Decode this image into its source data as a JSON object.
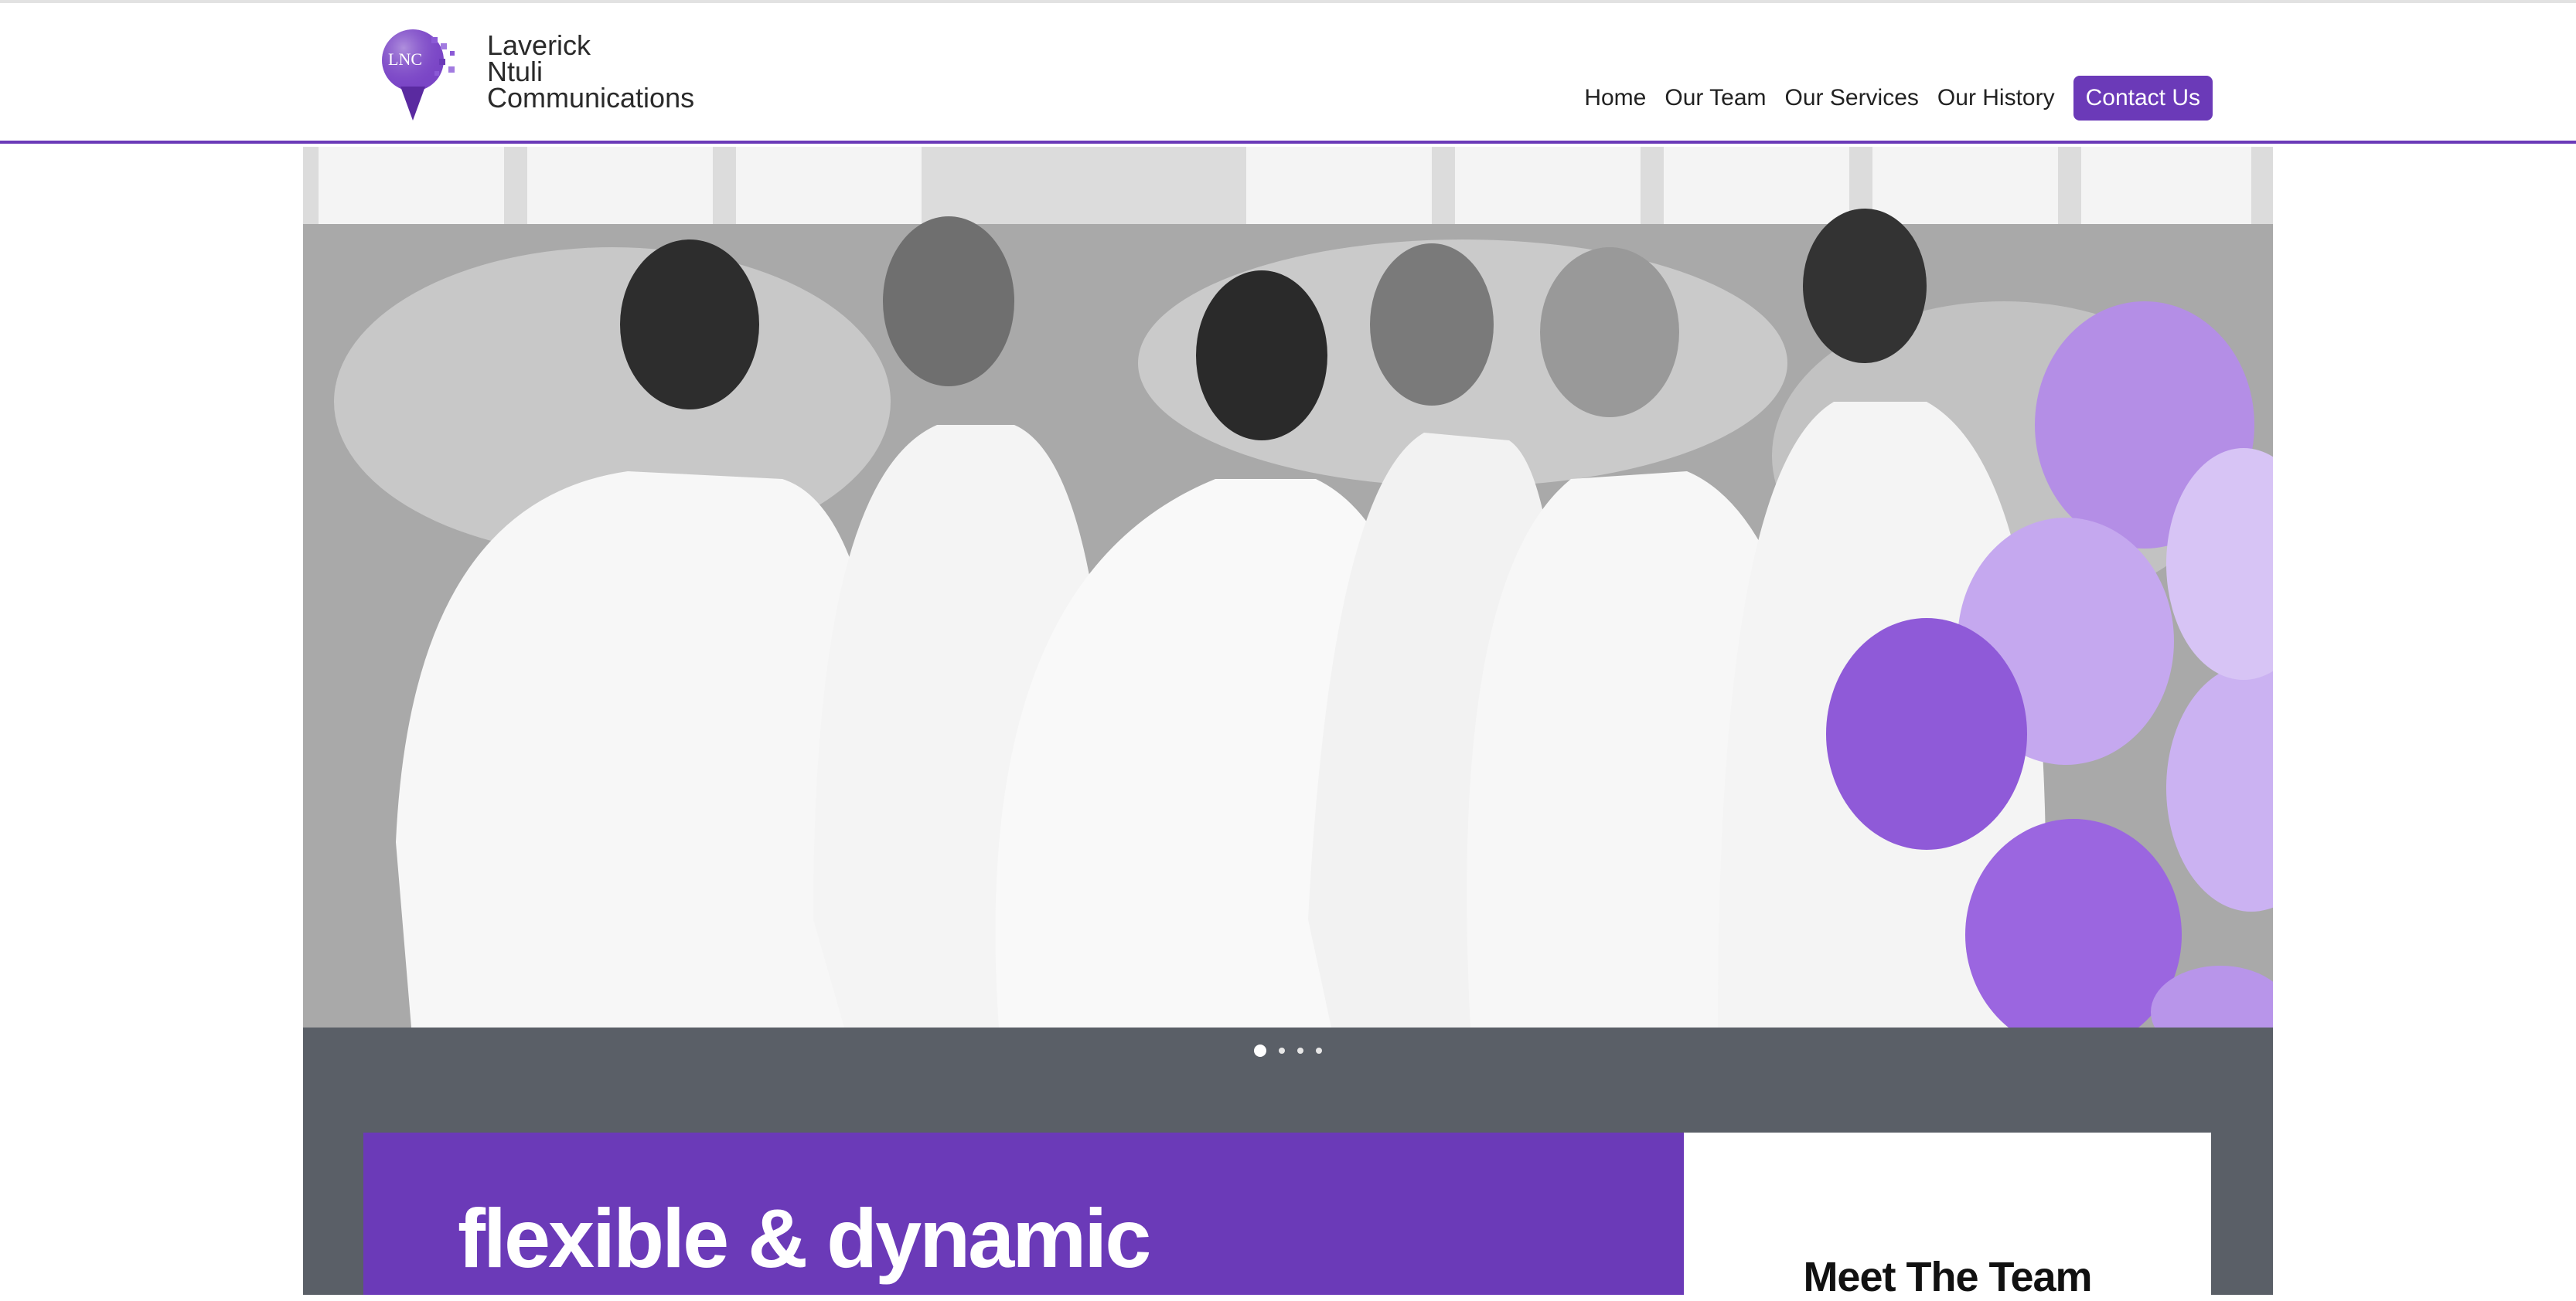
{
  "brand": {
    "name_line1": "Laverick",
    "name_line2": "Ntuli",
    "name_line3": "Communications",
    "logo_mark_text": "LNC",
    "accent_color": "#6b3ab8"
  },
  "nav": {
    "items": [
      "Home",
      "Our Team",
      "Our Services",
      "Our History"
    ],
    "cta": "Contact Us"
  },
  "hero": {
    "image_alt": "",
    "slides_total": 4,
    "active_slide": 1
  },
  "headline": "flexible & dynamic",
  "team_card": {
    "title": "Meet The Team"
  }
}
